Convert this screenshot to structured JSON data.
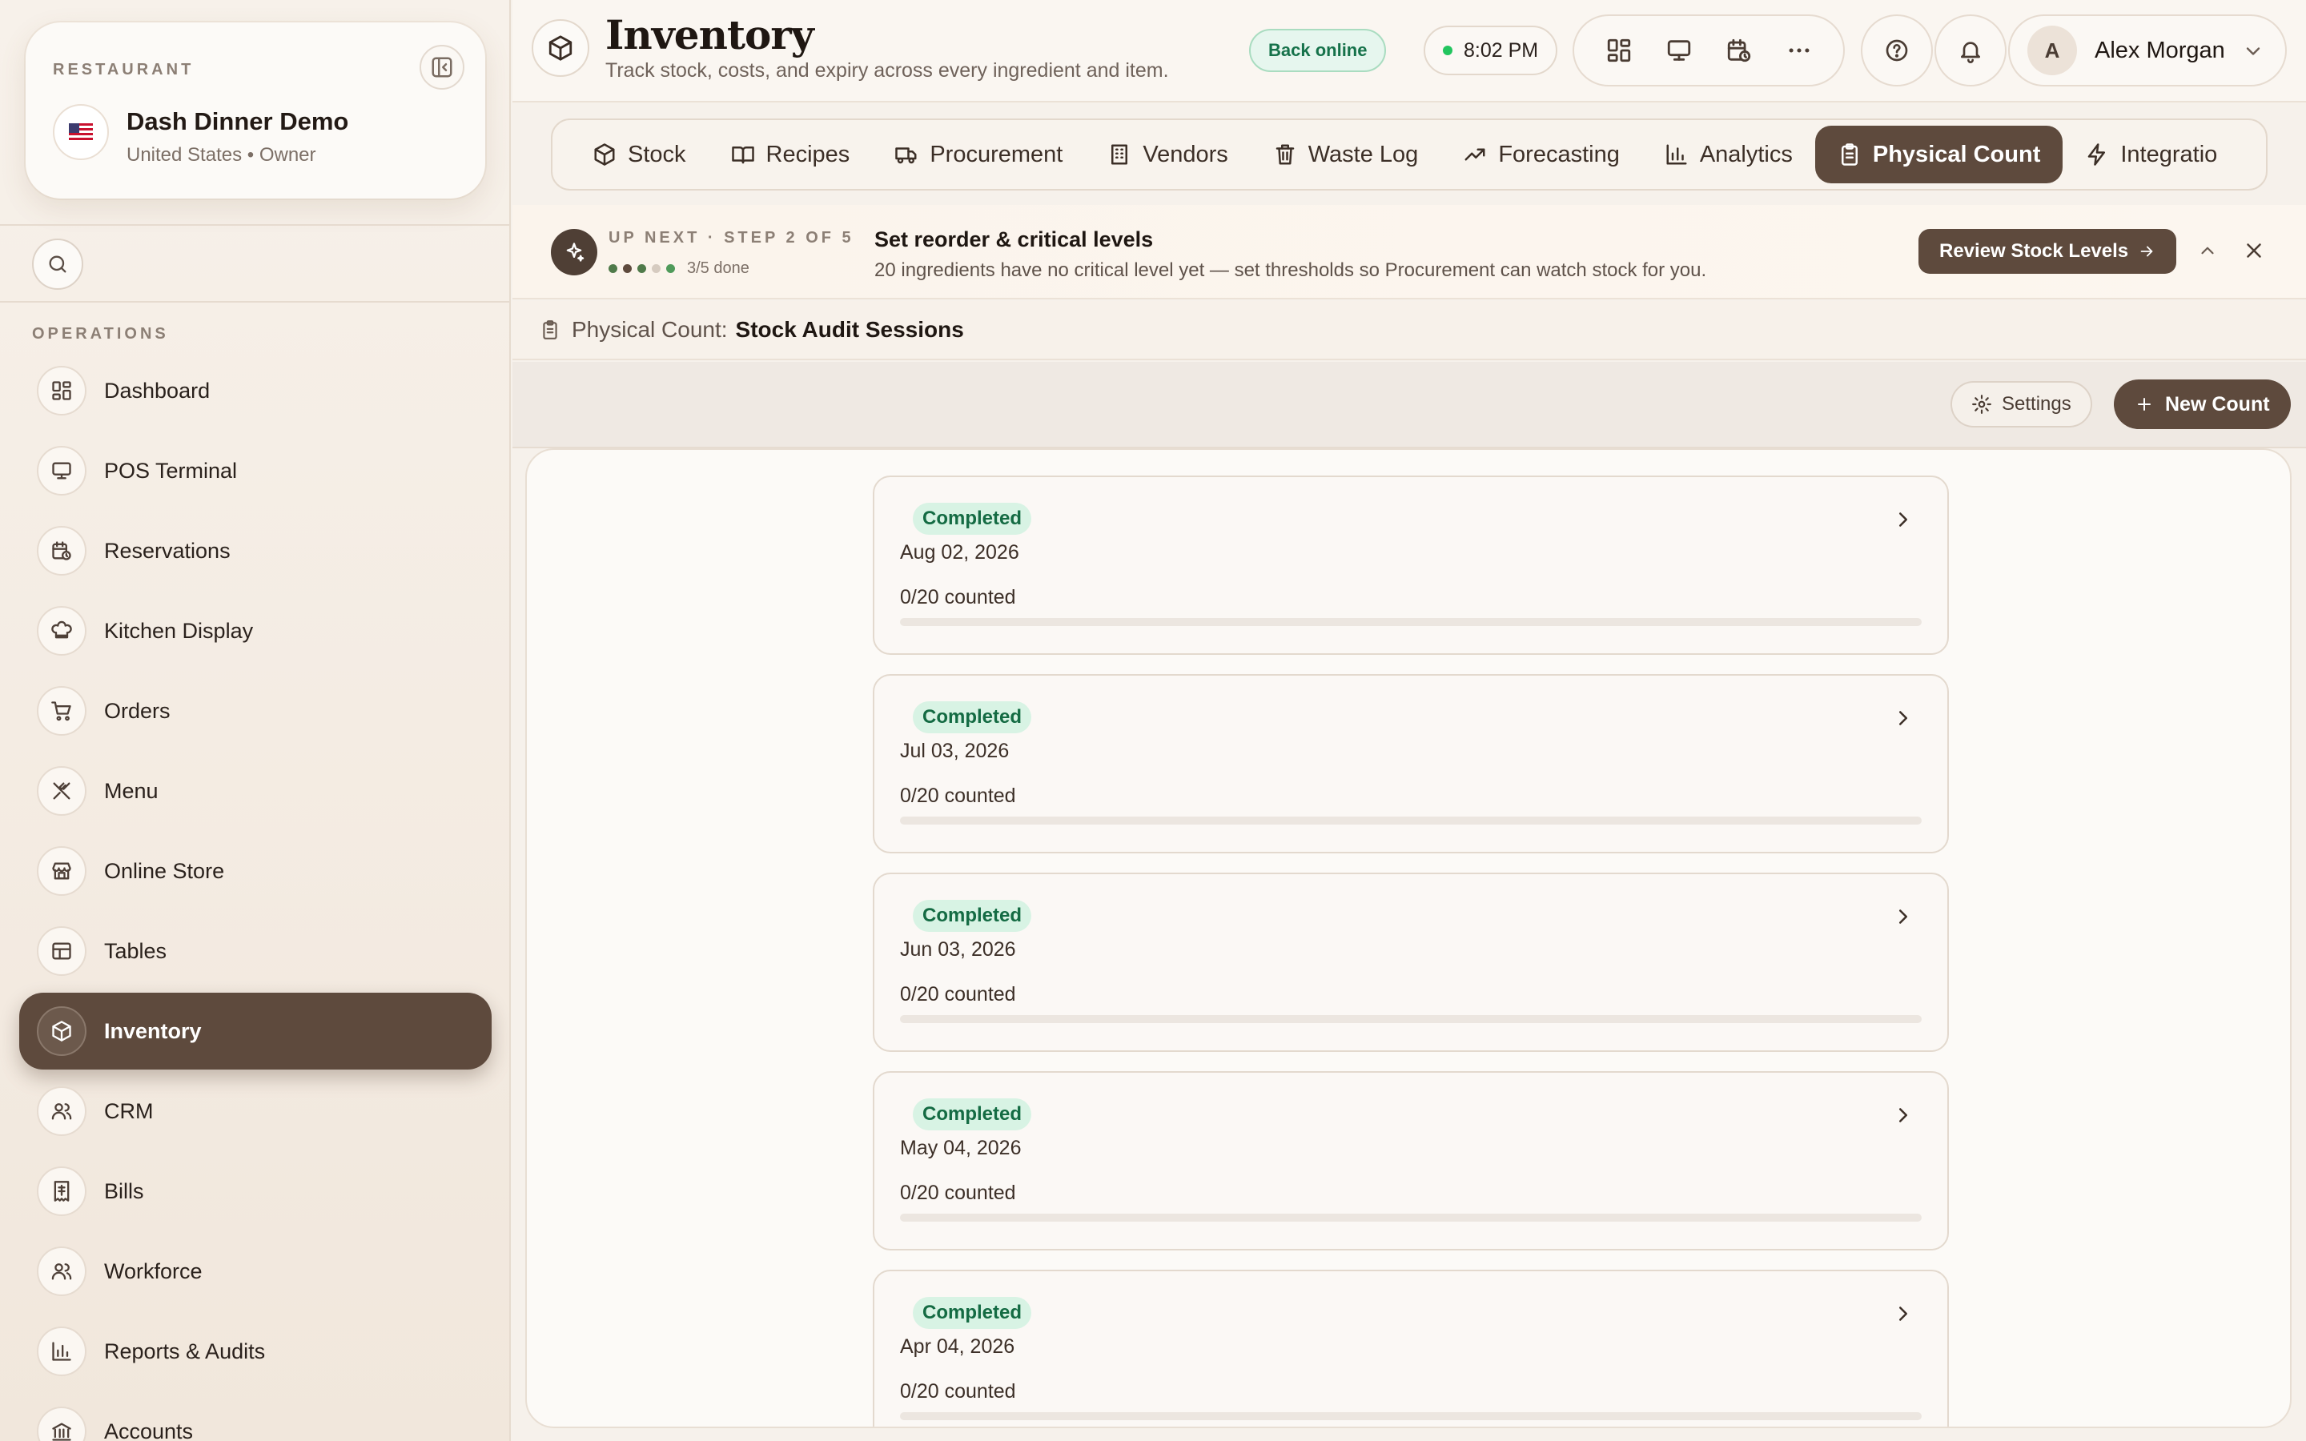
{
  "sidebar": {
    "restaurant_kicker": "RESTAURANT",
    "restaurant_name": "Dash Dinner Demo",
    "restaurant_sub": "United States • Owner",
    "flag_icon": "us-flag-icon",
    "section_label": "OPERATIONS",
    "items": [
      {
        "label": "Dashboard",
        "icon": "dashboard-icon",
        "active": false
      },
      {
        "label": "POS Terminal",
        "icon": "monitor-icon",
        "active": false
      },
      {
        "label": "Reservations",
        "icon": "calendar-clock-icon",
        "active": false
      },
      {
        "label": "Kitchen Display",
        "icon": "chef-hat-icon",
        "active": false
      },
      {
        "label": "Orders",
        "icon": "cart-icon",
        "active": false
      },
      {
        "label": "Menu",
        "icon": "utensils-icon",
        "active": false
      },
      {
        "label": "Online Store",
        "icon": "store-icon",
        "active": false
      },
      {
        "label": "Tables",
        "icon": "table-icon",
        "active": false
      },
      {
        "label": "Inventory",
        "icon": "package-icon",
        "active": true
      },
      {
        "label": "CRM",
        "icon": "users-icon",
        "active": false
      },
      {
        "label": "Bills",
        "icon": "receipt-icon",
        "active": false
      },
      {
        "label": "Workforce",
        "icon": "users-icon",
        "active": false
      },
      {
        "label": "Reports & Audits",
        "icon": "bar-chart-icon",
        "active": false
      },
      {
        "label": "Accounts",
        "icon": "bank-icon",
        "active": false
      }
    ]
  },
  "header": {
    "title": "Inventory",
    "subtitle": "Track stock, costs, and expiry across every ingredient and item.",
    "online_status": "Back online",
    "time": "8:02 PM",
    "user_initial": "A",
    "user_name": "Alex Morgan"
  },
  "tabs": [
    {
      "label": "Stock",
      "icon": "package-icon",
      "active": false
    },
    {
      "label": "Recipes",
      "icon": "book-icon",
      "active": false
    },
    {
      "label": "Procurement",
      "icon": "truck-icon",
      "active": false
    },
    {
      "label": "Vendors",
      "icon": "building-icon",
      "active": false
    },
    {
      "label": "Waste Log",
      "icon": "trash-icon",
      "active": false
    },
    {
      "label": "Forecasting",
      "icon": "trend-up-icon",
      "active": false
    },
    {
      "label": "Analytics",
      "icon": "bar-chart-icon",
      "active": false
    },
    {
      "label": "Physical Count",
      "icon": "clipboard-icon",
      "active": true
    },
    {
      "label": "Integratio",
      "icon": "bolt-icon",
      "active": false
    }
  ],
  "banner": {
    "kicker": "UP NEXT · STEP 2 OF 5",
    "progress_text": "3/5 done",
    "steps_done": 3,
    "steps_total": 5,
    "title": "Set reorder & critical levels",
    "description": "20 ingredients have no critical level yet — set thresholds so Procurement can watch stock for you.",
    "button_label": "Review Stock Levels"
  },
  "breadcrumb": {
    "prefix": "Physical Count:",
    "current": "Stock Audit Sessions"
  },
  "toolbar": {
    "settings_label": "Settings",
    "new_count_label": "New Count"
  },
  "sessions": [
    {
      "status": "Completed",
      "date": "Aug 02, 2026",
      "counted_text": "0/20 counted",
      "progress": 0
    },
    {
      "status": "Completed",
      "date": "Jul 03, 2026",
      "counted_text": "0/20 counted",
      "progress": 0
    },
    {
      "status": "Completed",
      "date": "Jun 03, 2026",
      "counted_text": "0/20 counted",
      "progress": 0
    },
    {
      "status": "Completed",
      "date": "May 04, 2026",
      "counted_text": "0/20 counted",
      "progress": 0
    },
    {
      "status": "Completed",
      "date": "Apr 04, 2026",
      "counted_text": "0/20 counted",
      "progress": 0
    }
  ],
  "colors": {
    "accent": "#5e4a3d",
    "online_green": "#22c55e",
    "badge_bg": "#d8f3e4",
    "badge_text": "#146b43"
  }
}
